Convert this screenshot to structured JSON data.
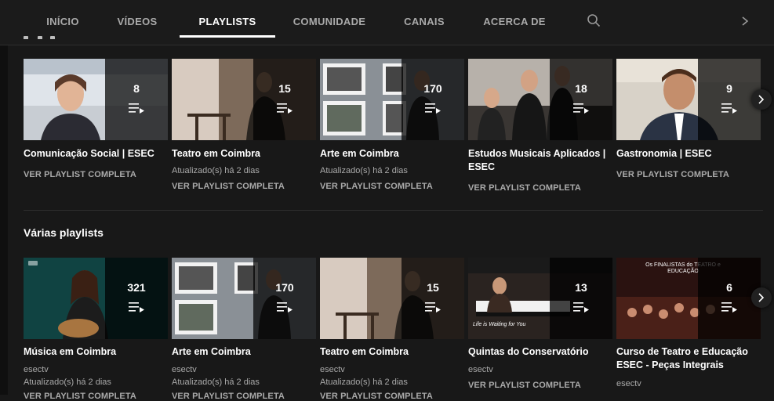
{
  "tabs": [
    {
      "label": "INÍCIO"
    },
    {
      "label": "VÍDEOS"
    },
    {
      "label": "PLAYLISTS"
    },
    {
      "label": "COMUNIDADE"
    },
    {
      "label": "CANAIS"
    },
    {
      "label": "ACERCA DE"
    }
  ],
  "active_tab": "PLAYLISTS",
  "common": {
    "view_full": "VER PLAYLIST COMPLETA",
    "updated": "Atualizado(s) há 2 dias",
    "channel": "esectv"
  },
  "shelf1": {
    "items": [
      {
        "title": "Comunicação Social | ESEC",
        "count": "8"
      },
      {
        "title": "Teatro em Coimbra",
        "count": "15"
      },
      {
        "title": "Arte em Coimbra",
        "count": "170"
      },
      {
        "title": "Estudos Musicais Aplicados | ESEC",
        "count": "18"
      },
      {
        "title": "Gastronomia | ESEC",
        "count": "9"
      }
    ]
  },
  "shelf2": {
    "title": "Várias playlists",
    "items": [
      {
        "title": "Música em Coimbra",
        "count": "321"
      },
      {
        "title": "Arte em Coimbra",
        "count": "170"
      },
      {
        "title": "Teatro em Coimbra",
        "count": "15"
      },
      {
        "title": "Quintas do Conservatório",
        "count": "13",
        "thumb_text": "Life is Waiting for You"
      },
      {
        "title": "Curso de Teatro e Educação ESEC - Peças Integrais",
        "count": "6",
        "thumb_text": "Os FINALISTAS do TEATRO e EDUCAÇÃO"
      }
    ]
  }
}
